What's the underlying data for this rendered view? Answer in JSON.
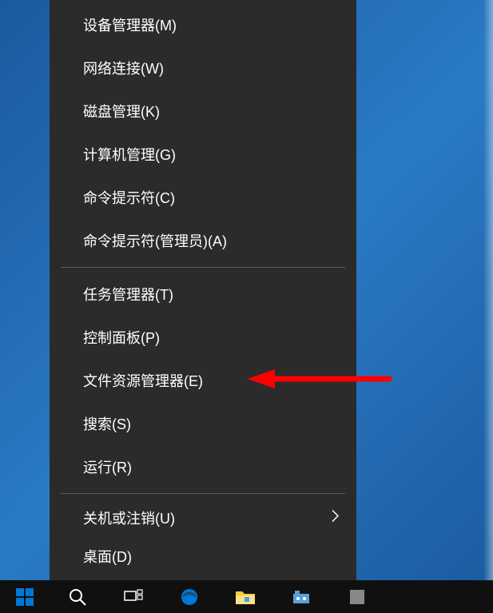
{
  "menu": {
    "group1": [
      {
        "label": "设备管理器(M)"
      },
      {
        "label": "网络连接(W)"
      },
      {
        "label": "磁盘管理(K)"
      },
      {
        "label": "计算机管理(G)"
      },
      {
        "label": "命令提示符(C)"
      },
      {
        "label": "命令提示符(管理员)(A)"
      }
    ],
    "group2": [
      {
        "label": "任务管理器(T)"
      },
      {
        "label": "控制面板(P)"
      },
      {
        "label": "文件资源管理器(E)"
      },
      {
        "label": "搜索(S)"
      },
      {
        "label": "运行(R)"
      }
    ],
    "group3": [
      {
        "label": "关机或注销(U)",
        "submenu": true
      },
      {
        "label": "桌面(D)"
      }
    ]
  },
  "annotation": {
    "target": "文件资源管理器(E)",
    "arrow_color": "#ff0000"
  },
  "taskbar": {
    "items": [
      "start",
      "search",
      "task-view",
      "edge",
      "file-explorer",
      "settings",
      "app"
    ]
  }
}
